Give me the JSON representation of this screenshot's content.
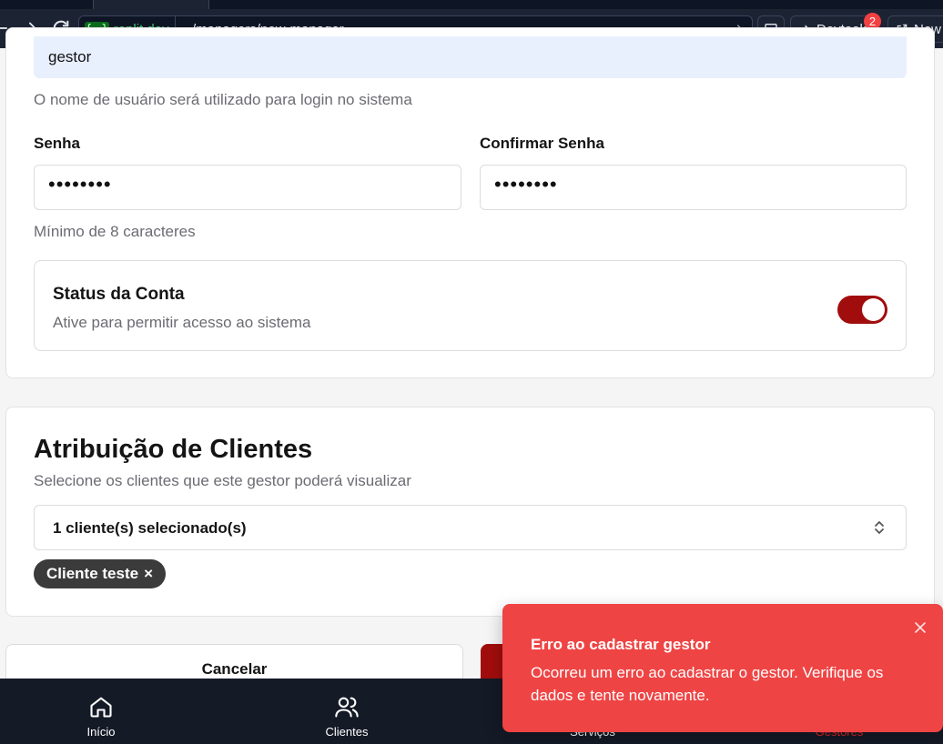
{
  "browser": {
    "url_domain_prefix": "{...}",
    "url_domain": ".replit.dev",
    "url_path": "/managers/new-manager",
    "devtools_label": "Devtools",
    "devtools_badge": "2",
    "new_tab_label": "New"
  },
  "form": {
    "username_value": "gestor",
    "username_hint": "O nome de usuário será utilizado para login no sistema",
    "password_label": "Senha",
    "password_value": "••••••••",
    "confirm_label": "Confirmar Senha",
    "confirm_value": "••••••••",
    "password_hint": "Mínimo de 8 caracteres",
    "status_title": "Status da Conta",
    "status_desc": "Ative para permitir acesso ao sistema",
    "status_enabled": true
  },
  "clients": {
    "title": "Atribuição de Clientes",
    "subtitle": "Selecione os clientes que este gestor poderá visualizar",
    "select_value": "1 cliente(s) selecionado(s)",
    "chip_label": "Cliente teste",
    "chip_remove": "×"
  },
  "actions": {
    "cancel_label": "Cancelar"
  },
  "bottom_nav": {
    "items": [
      {
        "label": "Início",
        "icon": "home-icon"
      },
      {
        "label": "Clientes",
        "icon": "users-icon"
      },
      {
        "label": "Serviços",
        "icon": "services-icon"
      },
      {
        "label": "Gestores",
        "icon": "managers-icon"
      }
    ]
  },
  "toast": {
    "title": "Erro ao cadastrar gestor",
    "description": "Ocorreu um erro ao cadastrar o gestor. Verifique os dados e tente novamente."
  },
  "colors": {
    "primary": "#a10d0d",
    "toast_bg": "#ef4444",
    "nav_bg": "#141a26",
    "active_nav": "#dc2626"
  }
}
